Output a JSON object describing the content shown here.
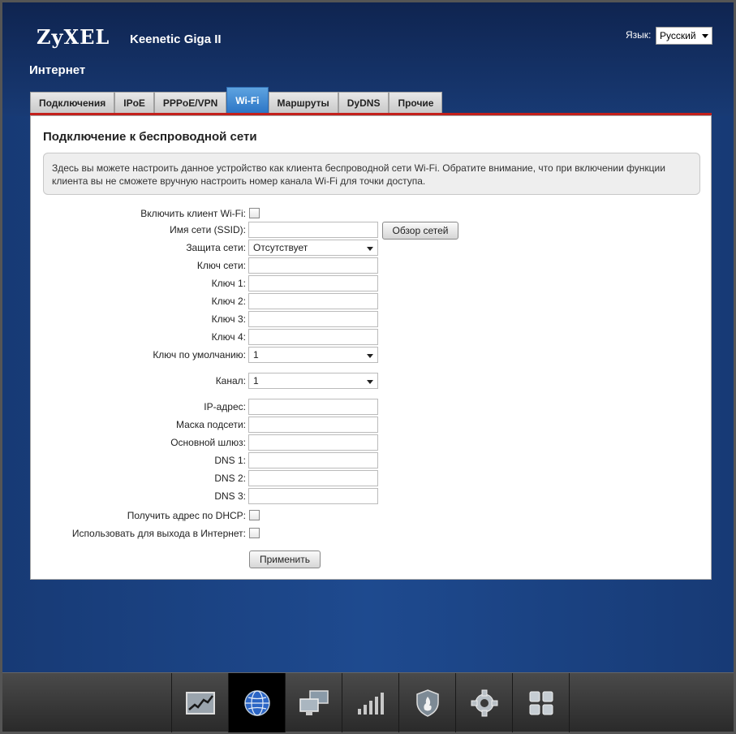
{
  "header": {
    "logo": "ZyXEL",
    "model": "Keenetic Giga II",
    "language_label": "Язык:",
    "language_value": "Русский",
    "section_title": "Интернет"
  },
  "tabs": [
    {
      "label": "Подключения",
      "active": false
    },
    {
      "label": "IPoE",
      "active": false
    },
    {
      "label": "PPPoE/VPN",
      "active": false
    },
    {
      "label": "Wi-Fi",
      "active": true
    },
    {
      "label": "Маршруты",
      "active": false
    },
    {
      "label": "DyDNS",
      "active": false
    },
    {
      "label": "Прочие",
      "active": false
    }
  ],
  "panel": {
    "title": "Подключение к беспроводной сети",
    "info": "Здесь вы можете настроить данное устройство как клиента беспроводной сети Wi-Fi. Обратите внимание, что при включении функции клиента вы не сможете вручную настроить номер канала Wi-Fi для точки доступа."
  },
  "form": {
    "enable_client_label": "Включить клиент Wi-Fi:",
    "enable_client_checked": false,
    "ssid_label": "Имя сети (SSID):",
    "ssid_value": "",
    "browse_button": "Обзор сетей",
    "security_label": "Защита сети:",
    "security_value": "Отсутствует",
    "network_key_label": "Ключ сети:",
    "key1_label": "Ключ 1:",
    "key2_label": "Ключ 2:",
    "key3_label": "Ключ 3:",
    "key4_label": "Ключ 4:",
    "default_key_label": "Ключ по умолчанию:",
    "default_key_value": "1",
    "channel_label": "Канал:",
    "channel_value": "1",
    "ip_label": "IP-адрес:",
    "mask_label": "Маска подсети:",
    "gateway_label": "Основной шлюз:",
    "dns1_label": "DNS 1:",
    "dns2_label": "DNS 2:",
    "dns3_label": "DNS 3:",
    "dhcp_label": "Получить адрес по DHCP:",
    "dhcp_checked": false,
    "use_internet_label": "Использовать для выхода в Интернет:",
    "use_internet_checked": false,
    "apply_button": "Применить"
  },
  "dock": [
    {
      "icon": "chart-icon",
      "active": false
    },
    {
      "icon": "globe-icon",
      "active": true
    },
    {
      "icon": "network-computers-icon",
      "active": false
    },
    {
      "icon": "signal-bars-icon",
      "active": false
    },
    {
      "icon": "shield-firewall-icon",
      "active": false
    },
    {
      "icon": "gear-icon",
      "active": false
    },
    {
      "icon": "apps-grid-icon",
      "active": false
    }
  ]
}
